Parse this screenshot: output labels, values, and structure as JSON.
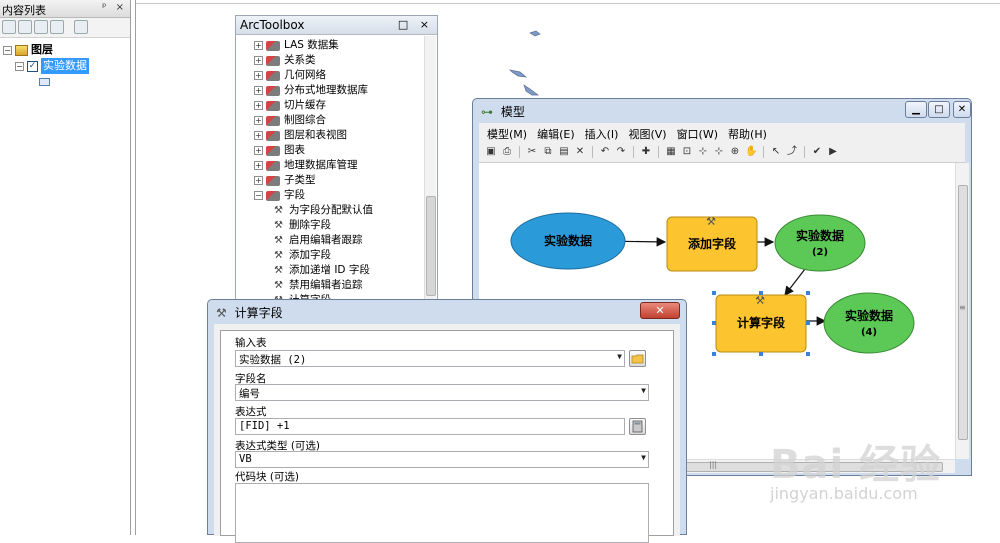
{
  "toc": {
    "title": "内容列表",
    "title_buttons": "ᵖ ×",
    "layers_group": "图层",
    "layer_name": "实验数据",
    "expand_minus": "−",
    "checked": "✓"
  },
  "arctoolbox": {
    "title": "ArcToolbox",
    "title_buttons": "□ ×",
    "items": [
      {
        "label": "LAS 数据集",
        "kind": "toolset",
        "expand": "+"
      },
      {
        "label": "关系类",
        "kind": "toolset",
        "expand": "+"
      },
      {
        "label": "几何网络",
        "kind": "toolset",
        "expand": "+"
      },
      {
        "label": "分布式地理数据库",
        "kind": "toolset",
        "expand": "+"
      },
      {
        "label": "切片缓存",
        "kind": "toolset",
        "expand": "+"
      },
      {
        "label": "制图综合",
        "kind": "toolset",
        "expand": "+"
      },
      {
        "label": "图层和表视图",
        "kind": "toolset",
        "expand": "+"
      },
      {
        "label": "图表",
        "kind": "toolset",
        "expand": "+"
      },
      {
        "label": "地理数据库管理",
        "kind": "toolset",
        "expand": "+"
      },
      {
        "label": "子类型",
        "kind": "toolset",
        "expand": "+"
      },
      {
        "label": "字段",
        "kind": "toolset",
        "expand": "−"
      },
      {
        "label": "为字段分配默认值",
        "kind": "tool"
      },
      {
        "label": "删除字段",
        "kind": "tool"
      },
      {
        "label": "启用编辑者跟踪",
        "kind": "tool"
      },
      {
        "label": "添加字段",
        "kind": "tool"
      },
      {
        "label": "添加递增 ID 字段",
        "kind": "tool"
      },
      {
        "label": "禁用编辑者追踪",
        "kind": "tool"
      },
      {
        "label": "计算字段",
        "kind": "tool"
      }
    ]
  },
  "model": {
    "title": "模型",
    "menu": [
      "模型(M)",
      "编辑(E)",
      "插入(I)",
      "视图(V)",
      "窗口(W)",
      "帮助(H)"
    ],
    "toolbar_icons": [
      "save-icon",
      "print-icon",
      "cut-icon",
      "copy-icon",
      "paste-icon",
      "delete-icon",
      "undo-icon",
      "redo-icon",
      "add-data-icon",
      "auto-layout-icon",
      "full-extent-icon",
      "zoom-in-icon",
      "zoom-out-icon",
      "zoom-icon",
      "pan-icon",
      "select-icon",
      "connect-icon",
      "validate-icon",
      "run-icon"
    ],
    "toolbar_glyphs": [
      "▣",
      "⎙",
      "✂",
      "⧉",
      "▤",
      "✕",
      "↶",
      "↷",
      "✚",
      "▦",
      "⊡",
      "⊹",
      "⊹",
      "⊕",
      "✋",
      "↖",
      "⤴",
      "✔",
      "▶"
    ],
    "buttons": {
      "minimize": "▁",
      "maximize": "□",
      "close": "✕"
    },
    "nodes": {
      "input_data": "实验数据",
      "add_field": "添加字段",
      "output2": [
        "实验数据",
        "(2)"
      ],
      "calc_field": "计算字段",
      "output4": [
        "实验数据",
        "(4)"
      ]
    },
    "scroll_grip": "≡",
    "hscroll_grip": "|||",
    "colors": {
      "data_blue": "#2b9ad9",
      "tool_yellow": "#fcc52f",
      "output_green": "#5cc956",
      "selection": "#3a82d6"
    }
  },
  "calc_field_dialog": {
    "title": "计算字段",
    "close": "✕",
    "input_table_label": "输入表",
    "input_table_value": "实验数据 (2)",
    "field_name_label": "字段名",
    "field_name_value": "编号",
    "expression_label": "表达式",
    "expression_value": "[FID] +1",
    "expression_type_label": "表达式类型 (可选)",
    "expression_type_value": "VB",
    "code_block_label": "代码块 (可选)"
  },
  "watermark": {
    "logo": "Bai 经验",
    "url": "jingyan.baidu.com"
  }
}
